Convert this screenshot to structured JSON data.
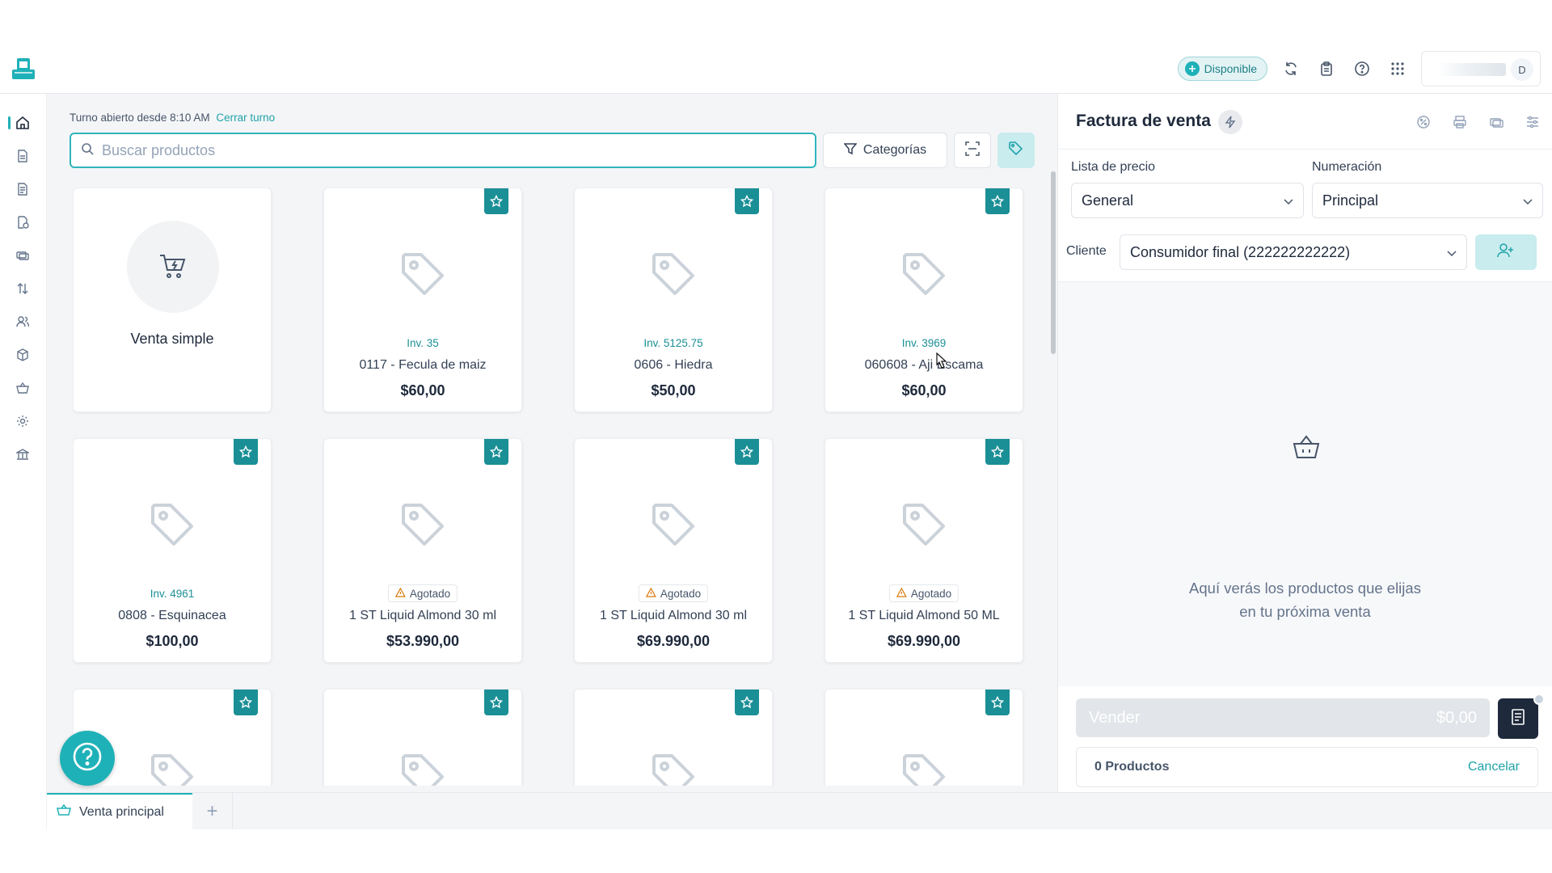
{
  "colors": {
    "accent": "#1fb1b8",
    "accent_dark": "#1b8f96",
    "accent_light": "#c9ecee",
    "text": "#334155",
    "muted": "#94a3b8"
  },
  "header": {
    "logo": "store-logo-icon",
    "status": "Disponible",
    "icons": [
      "sync-icon",
      "clipboard-icon",
      "help-circle-icon",
      "apps-grid-icon"
    ],
    "avatar_initial": "D"
  },
  "sidebar": {
    "items": [
      {
        "icon": "home-icon",
        "active": true
      },
      {
        "icon": "document-icon"
      },
      {
        "icon": "document-lines-icon"
      },
      {
        "icon": "document-clock-icon"
      },
      {
        "icon": "money-icon"
      },
      {
        "icon": "transfer-arrows-icon"
      },
      {
        "icon": "users-icon"
      },
      {
        "icon": "box-icon"
      },
      {
        "icon": "basket-icon"
      },
      {
        "icon": "settings-icon"
      },
      {
        "icon": "bank-icon"
      }
    ]
  },
  "shift": {
    "text": "Turno abierto desde 8:10 AM",
    "close_link": "Cerrar turno"
  },
  "search": {
    "placeholder": "Buscar productos"
  },
  "toolbar": {
    "categories_label": "Categorías"
  },
  "simple_sale": {
    "label": "Venta simple"
  },
  "products": [
    {
      "inv": "Inv. 35",
      "name": "0117 - Fecula de maiz",
      "price": "$60,00"
    },
    {
      "inv": "Inv. 5125.75",
      "name": "0606 - Hiedra",
      "price": "$50,00"
    },
    {
      "inv": "Inv. 3969",
      "name": "060608 - Aji Escama",
      "price": "$60,00"
    },
    {
      "inv": "Inv. 4961",
      "name": "0808 - Esquinacea",
      "price": "$100,00"
    },
    {
      "status": "Agotado",
      "name": "1 ST Liquid Almond 30 ml",
      "price": "$53.990,00"
    },
    {
      "status": "Agotado",
      "name": "1 ST Liquid Almond 30 ml",
      "price": "$69.990,00"
    },
    {
      "status": "Agotado",
      "name": "1 ST Liquid Almond 50 ML",
      "price": "$69.990,00"
    }
  ],
  "tabs": [
    {
      "label": "Venta principal"
    }
  ],
  "invoice": {
    "title": "Factura de venta",
    "price_list_label": "Lista de precio",
    "price_list_value": "General",
    "numbering_label": "Numeración",
    "numbering_value": "Principal",
    "client_label": "Cliente",
    "client_value": "Consumidor final (222222222222)",
    "empty_line1": "Aquí verás los productos que elijas",
    "empty_line2": "en tu próxima venta",
    "sell_label": "Vender",
    "sell_total": "$0,00",
    "products_count": "0 Productos",
    "cancel_label": "Cancelar"
  }
}
